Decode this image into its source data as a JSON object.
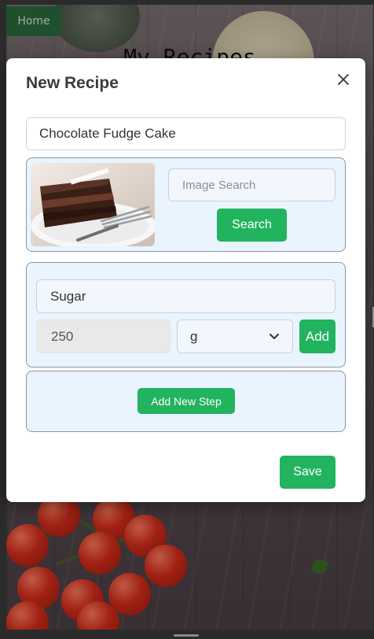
{
  "background": {
    "home_label": "Home",
    "app_title": "My Recipes"
  },
  "modal": {
    "title": "New Recipe",
    "close_icon": "close-icon",
    "recipe_name_value": "Chocolate Fudge Cake",
    "image_section": {
      "photo_icon": "recipe-photo",
      "search_placeholder": "Image Search",
      "search_button": "Search"
    },
    "ingredient_section": {
      "name_value": "Sugar",
      "quantity_value": "250",
      "unit_selected": "g",
      "unit_dropdown_icon": "chevron-down-icon",
      "add_button": "Add"
    },
    "steps_section": {
      "add_step_button": "Add New Step"
    },
    "save_button": "Save"
  },
  "colors": {
    "accent_green": "#22b35f",
    "panel_bg": "#eaf4ff",
    "home_green": "#2a6b3e"
  }
}
